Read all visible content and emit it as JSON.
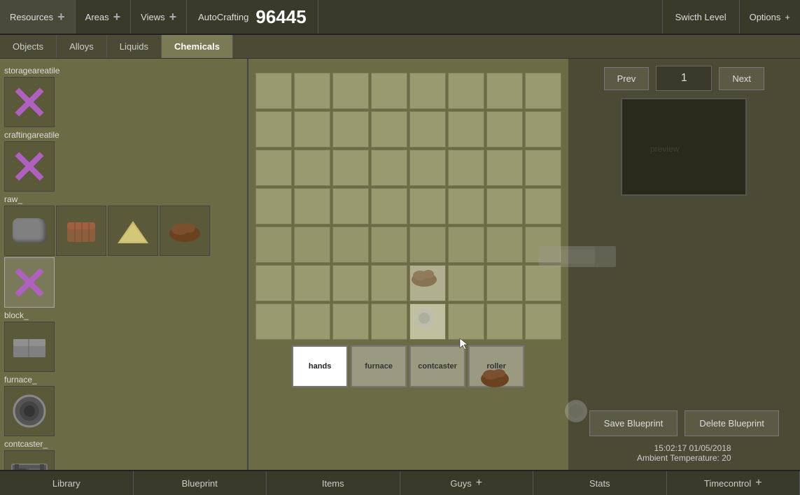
{
  "toolbar": {
    "resources_label": "Resources",
    "areas_label": "Areas",
    "views_label": "Views",
    "autocrafting_label": "AutoCrafting",
    "count": "96445",
    "switch_level_label": "Swicth Level",
    "options_label": "Options",
    "plus": "+"
  },
  "category_tabs": {
    "tabs": [
      {
        "id": "objects",
        "label": "Objects",
        "active": false
      },
      {
        "id": "alloys",
        "label": "Alloys",
        "active": false
      },
      {
        "id": "liquids",
        "label": "Liquids",
        "active": false
      },
      {
        "id": "chemicals",
        "label": "Chemicals",
        "active": true
      }
    ]
  },
  "left_panel": {
    "sections": [
      {
        "id": "storageareatile",
        "label": "storageareatile",
        "items": [
          {
            "type": "x-icon"
          }
        ]
      },
      {
        "id": "craftingareatile",
        "label": "craftingareatile",
        "items": [
          {
            "type": "x-icon"
          }
        ]
      },
      {
        "id": "raw",
        "label": "raw_",
        "items": [
          {
            "type": "stone"
          },
          {
            "type": "wood"
          },
          {
            "type": "sand"
          },
          {
            "type": "dirt"
          },
          {
            "type": "x-icon"
          }
        ]
      },
      {
        "id": "block",
        "label": "block_",
        "items": [
          {
            "type": "block"
          }
        ]
      },
      {
        "id": "furnace",
        "label": "furnace_",
        "items": [
          {
            "type": "furnace"
          }
        ]
      },
      {
        "id": "contcaster",
        "label": "contcaster_",
        "items": [
          {
            "type": "contcaster"
          }
        ]
      }
    ]
  },
  "grid": {
    "cols": 8,
    "rows": 7,
    "highlighted_cells": [
      44,
      52
    ],
    "sprite_cells": [
      44,
      52
    ]
  },
  "right_panel": {
    "prev_label": "Prev",
    "next_label": "Next",
    "page": "1",
    "save_label": "Save Blueprint",
    "delete_label": "Delete Blueprint"
  },
  "station_tabs": [
    {
      "id": "hands",
      "label": "hands",
      "active": true
    },
    {
      "id": "furnace",
      "label": "furnace",
      "active": false
    },
    {
      "id": "contcaster",
      "label": "contcaster",
      "active": false
    },
    {
      "id": "roller",
      "label": "roller",
      "active": false
    }
  ],
  "bottom_tabs": [
    {
      "id": "library",
      "label": "Library",
      "has_plus": false
    },
    {
      "id": "blueprint",
      "label": "Blueprint",
      "has_plus": false
    },
    {
      "id": "items",
      "label": "Items",
      "has_plus": false
    },
    {
      "id": "guys",
      "label": "Guys",
      "has_plus": true
    },
    {
      "id": "stats",
      "label": "Stats",
      "has_plus": false
    },
    {
      "id": "timecontrol",
      "label": "Timecontrol",
      "has_plus": true
    }
  ],
  "timestamp": {
    "time": "15:02:17 01/05/2018",
    "temp_label": "Ambient Temperature: 20"
  }
}
